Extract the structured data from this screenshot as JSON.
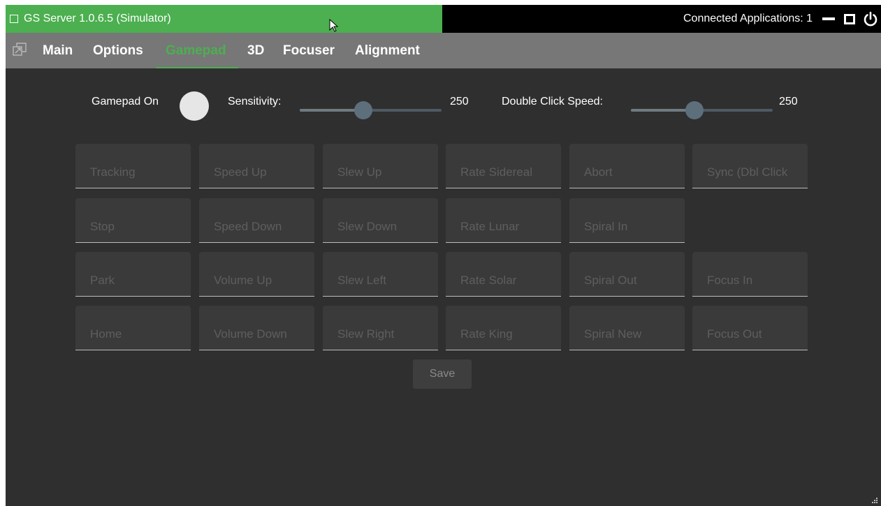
{
  "title": {
    "app_title": "GS Server 1.0.6.5 (Simulator)",
    "connected": "Connected Applications: 1",
    "icons": [
      "app-window-icon",
      "minimize-icon",
      "maximize-icon",
      "power-icon"
    ]
  },
  "menu": {
    "tabs": [
      {
        "label": "Main"
      },
      {
        "label": "Options"
      },
      {
        "label": "Gamepad",
        "active": true
      },
      {
        "label": "3D"
      },
      {
        "label": "Focuser"
      },
      {
        "label": "Alignment"
      }
    ]
  },
  "controls": {
    "gamepad_label": "Gamepad On",
    "sensitivity_label": "Sensitivity:",
    "sensitivity_value": "250",
    "sensitivity_fraction": 0.45,
    "dblclick_label": "Double Click Speed:",
    "dblclick_value": "250",
    "dblclick_fraction": 0.45
  },
  "grid": {
    "rows": [
      [
        "Tracking",
        "Speed Up",
        "Slew Up",
        "Rate Sidereal",
        "Abort",
        "Sync (Dbl Click"
      ],
      [
        "Stop",
        "Speed Down",
        "Slew Down",
        "Rate Lunar",
        "Spiral In",
        ""
      ],
      [
        "Park",
        "Volume Up",
        "Slew Left",
        "Rate Solar",
        "Spiral Out",
        "Focus In"
      ],
      [
        "Home",
        "Volume Down",
        "Slew Right",
        "Rate King",
        "Spiral New",
        "Focus Out"
      ]
    ]
  },
  "save_label": "Save",
  "colors": {
    "accent": "#4caf50",
    "menu_bg": "#777777",
    "content_bg": "#2f2f2f",
    "button_bg": "#3a3a3a"
  }
}
